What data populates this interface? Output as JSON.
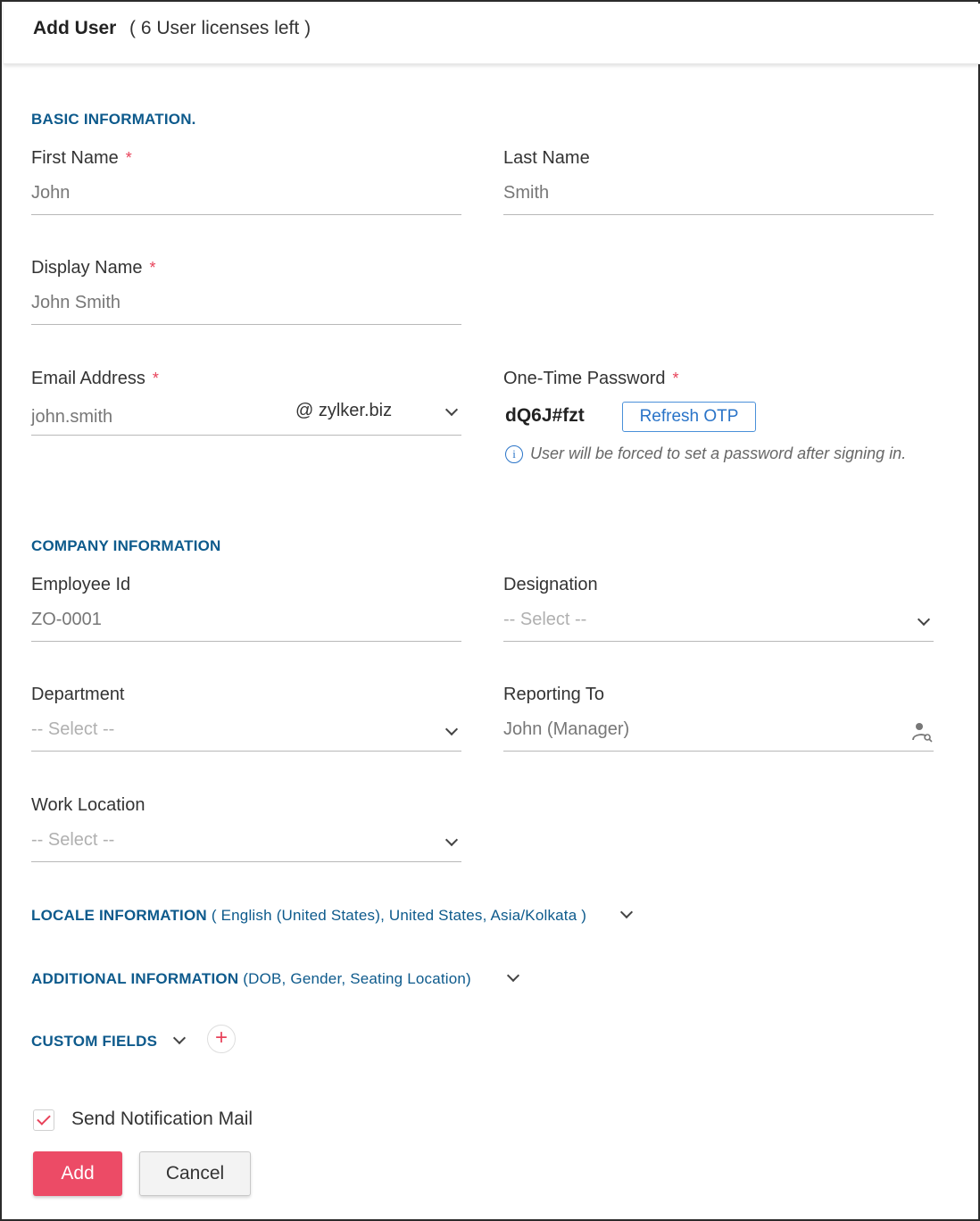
{
  "header": {
    "title": "Add User",
    "subtitle": "( 6 User licenses left )"
  },
  "basic": {
    "section_title": "BASIC INFORMATION.",
    "first_name": {
      "label": "First Name",
      "value": "John"
    },
    "last_name": {
      "label": "Last Name",
      "value": "Smith"
    },
    "display_name": {
      "label": "Display Name",
      "value": "John Smith"
    },
    "email": {
      "label": "Email Address",
      "value": "john.smith",
      "domain": "@ zylker.biz"
    },
    "otp": {
      "label": "One-Time Password",
      "value": "dQ6J#fzt",
      "refresh_label": "Refresh OTP",
      "hint": "User will be forced to set a password after signing in."
    },
    "required_marker": "*"
  },
  "company": {
    "section_title": "COMPANY INFORMATION",
    "employee_id": {
      "label": "Employee Id",
      "value": "ZO-0001"
    },
    "designation": {
      "label": "Designation",
      "value": "-- Select --"
    },
    "department": {
      "label": "Department",
      "value": "-- Select --"
    },
    "reporting_to": {
      "label": "Reporting To",
      "value": "John (Manager)"
    },
    "work_location": {
      "label": "Work Location",
      "value": "-- Select --"
    }
  },
  "locale": {
    "title": "LOCALE INFORMATION",
    "summary": "( English (United States), United States, Asia/Kolkata )"
  },
  "additional": {
    "title": "ADDITIONAL INFORMATION",
    "summary": "(DOB, Gender, Seating Location)"
  },
  "custom_fields": {
    "title": "CUSTOM FIELDS",
    "add_symbol": "+"
  },
  "notification": {
    "label": "Send Notification Mail",
    "checked": true
  },
  "actions": {
    "add_label": "Add",
    "cancel_label": "Cancel"
  },
  "colors": {
    "accent": "#ec4b66",
    "section": "#0d5a8c",
    "link": "#2a74c8"
  },
  "icons": {
    "info": "info-icon",
    "person_search": "person-search-icon",
    "chevron": "chevron-down-icon",
    "plus": "plus-icon",
    "check": "check-icon"
  }
}
